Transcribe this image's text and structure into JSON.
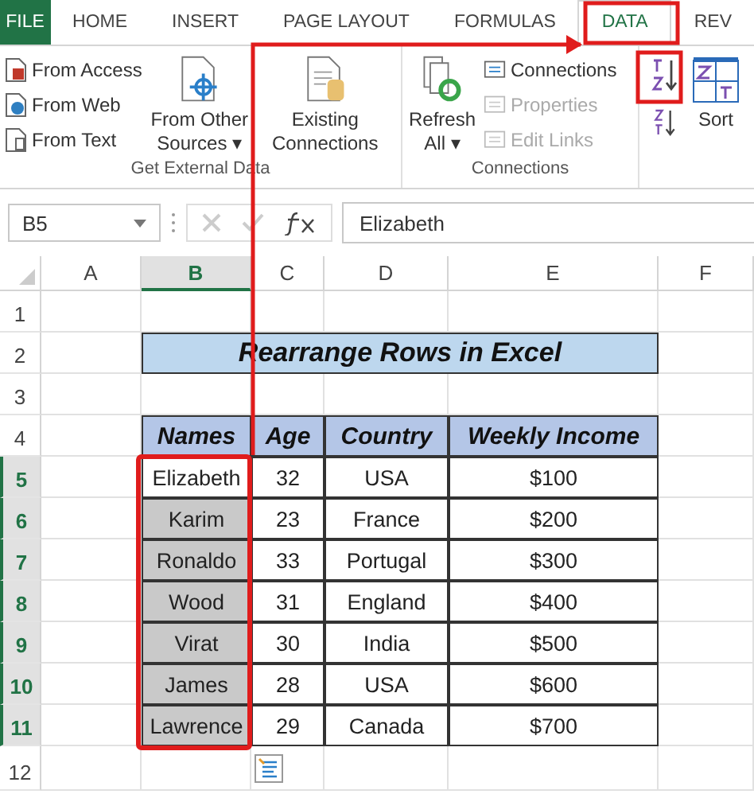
{
  "tabs": [
    {
      "label": "FILE",
      "kind": "file",
      "selected": false
    },
    {
      "label": "HOME",
      "kind": "tab",
      "selected": false
    },
    {
      "label": "INSERT",
      "kind": "tab",
      "selected": false
    },
    {
      "label": "PAGE LAYOUT",
      "kind": "tab",
      "selected": false
    },
    {
      "label": "FORMULAS",
      "kind": "tab",
      "selected": false
    },
    {
      "label": "DATA",
      "kind": "tab",
      "selected": true
    },
    {
      "label": "REV",
      "kind": "tab",
      "selected": false
    }
  ],
  "ribbon": {
    "get_external_data": {
      "label": "Get External Data",
      "small_buttons": [
        {
          "label": "From Access"
        },
        {
          "label": "From Web"
        },
        {
          "label": "From Text"
        }
      ],
      "from_other_sources": [
        "From Other",
        "Sources ▾"
      ],
      "existing_connections": [
        "Existing",
        "Connections"
      ]
    },
    "connections": {
      "label": "Connections",
      "refresh_all": [
        "Refresh",
        "All ▾"
      ],
      "small_buttons": [
        {
          "label": "Connections",
          "disabled": false
        },
        {
          "label": "Properties",
          "disabled": true
        },
        {
          "label": "Edit Links",
          "disabled": true
        }
      ]
    },
    "sort_filter": {
      "sort": "Sort"
    }
  },
  "formula_bar": {
    "name_box": "B5",
    "value": "Elizabeth"
  },
  "sheet": {
    "columns": [
      {
        "label": "A",
        "selected": false
      },
      {
        "label": "B",
        "selected": true
      },
      {
        "label": "C",
        "selected": false
      },
      {
        "label": "D",
        "selected": false
      },
      {
        "label": "E",
        "selected": false
      },
      {
        "label": "F",
        "selected": false
      }
    ],
    "rows": [
      {
        "label": "1",
        "selected": false
      },
      {
        "label": "2",
        "selected": false
      },
      {
        "label": "3",
        "selected": false
      },
      {
        "label": "4",
        "selected": false
      },
      {
        "label": "5",
        "selected": true
      },
      {
        "label": "6",
        "selected": true
      },
      {
        "label": "7",
        "selected": true
      },
      {
        "label": "8",
        "selected": true
      },
      {
        "label": "9",
        "selected": true
      },
      {
        "label": "10",
        "selected": true
      },
      {
        "label": "11",
        "selected": true
      },
      {
        "label": "12",
        "selected": false
      }
    ],
    "title": "Rearrange Rows in Excel",
    "headers": [
      "Names",
      "Age",
      "Country",
      "Weekly Income"
    ],
    "data": [
      {
        "cells": [
          "Elizabeth",
          "32",
          "USA",
          "$100"
        ],
        "active": true
      },
      {
        "cells": [
          "Karim",
          "23",
          "France",
          "$200"
        ],
        "active": false
      },
      {
        "cells": [
          "Ronaldo",
          "33",
          "Portugal",
          "$300"
        ],
        "active": false
      },
      {
        "cells": [
          "Wood",
          "31",
          "England",
          "$400"
        ],
        "active": false
      },
      {
        "cells": [
          "Virat",
          "30",
          "India",
          "$500"
        ],
        "active": false
      },
      {
        "cells": [
          "James",
          "28",
          "USA",
          "$600"
        ],
        "active": false
      },
      {
        "cells": [
          "Lawrence",
          "29",
          "Canada",
          "$700"
        ],
        "active": false
      }
    ]
  }
}
